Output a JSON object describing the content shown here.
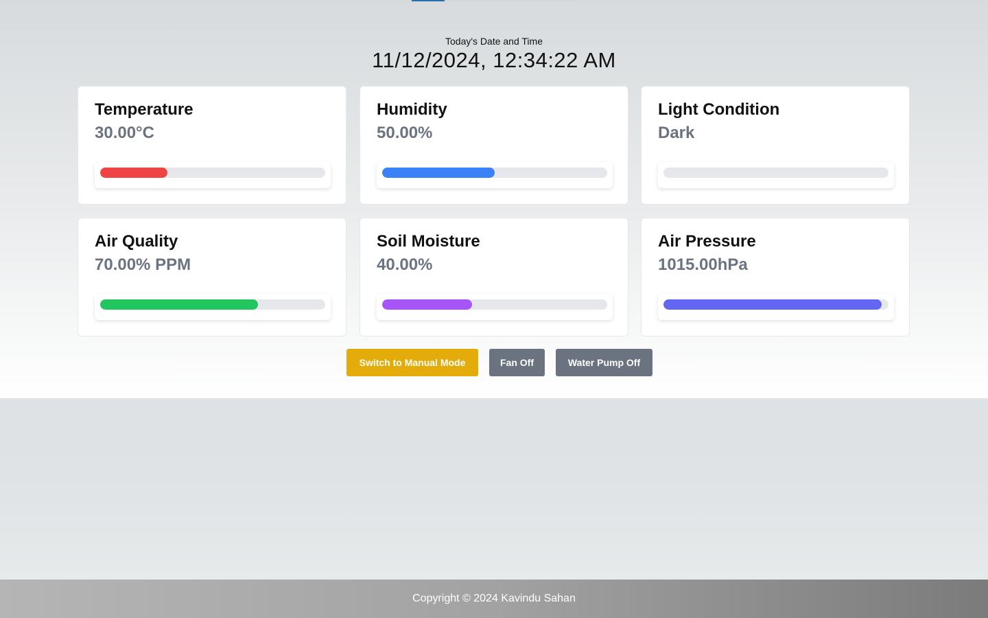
{
  "header": {
    "date_label": "Today's Date and Time",
    "date_value": "11/12/2024, 12:34:22 AM"
  },
  "cards": [
    {
      "title": "Temperature",
      "value": "30.00°C",
      "level": 0.3,
      "color": "#ef4444"
    },
    {
      "title": "Humidity",
      "value": "50.00%",
      "level": 0.5,
      "color": "#3b82f6"
    },
    {
      "title": "Light Condition",
      "value": "Dark",
      "level": 0.0,
      "color": "#facc15"
    },
    {
      "title": "Air Quality",
      "value": "70.00% PPM",
      "level": 0.7,
      "color": "#22c55e"
    },
    {
      "title": "Soil Moisture",
      "value": "40.00%",
      "level": 0.4,
      "color": "#a855f7"
    },
    {
      "title": "Air Pressure",
      "value": "1015.00hPa",
      "level": 0.97,
      "color": "#6366f1"
    }
  ],
  "controls": {
    "manual_mode_label": "Switch to Manual Mode",
    "fan_label": "Fan Off",
    "pump_label": "Water Pump Off"
  },
  "footer": {
    "copyright": "Copyright © 2024 Kavindu Sahan"
  }
}
